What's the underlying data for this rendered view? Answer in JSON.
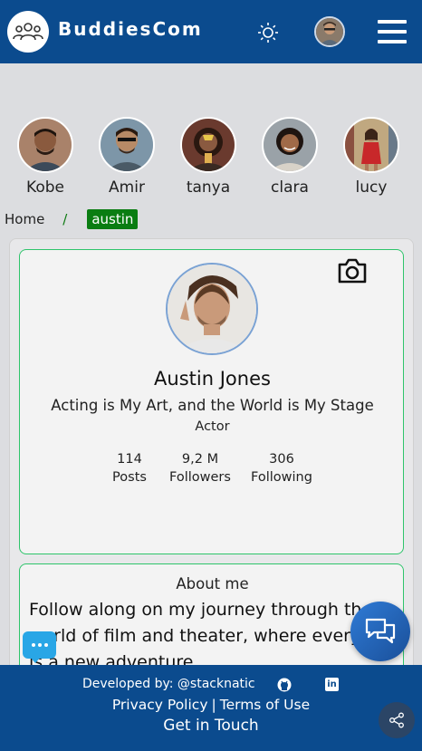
{
  "header": {
    "brand": "BuddiesCom",
    "theme_icon": "sun-icon",
    "menu_icon": "hamburger-icon"
  },
  "friends": [
    {
      "name": "Kobe"
    },
    {
      "name": "Amir"
    },
    {
      "name": "tanya"
    },
    {
      "name": "clara"
    },
    {
      "name": "lucy"
    }
  ],
  "breadcrumb": {
    "home": "Home",
    "separator": "/",
    "current": "austin"
  },
  "profile": {
    "name": "Austin Jones",
    "tagline": "Acting is My Art, and the World is My Stage",
    "role": "Actor",
    "stats": [
      {
        "value": "114",
        "label": "Posts"
      },
      {
        "value": "9,2 M",
        "label": "Followers"
      },
      {
        "value": "306",
        "label": "Following"
      }
    ]
  },
  "about": {
    "title": "About me",
    "text": "Follow along on my journey through the world of film and theater, where every role is a new adventure."
  },
  "footer": {
    "developed_by": "Developed by: @stacknatic",
    "privacy": "Privacy Policy",
    "separator": "|",
    "terms": "Terms of Use",
    "get_in_touch": "Get in Touch"
  },
  "colors": {
    "brand_blue": "#0b4b8e",
    "accent_green": "#2ec46b",
    "crumb_green": "#0a7d12",
    "chat_blue": "#29a6e6"
  }
}
